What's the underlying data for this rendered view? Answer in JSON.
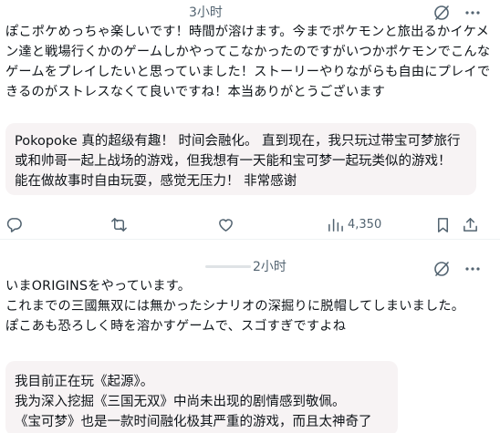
{
  "posts": [
    {
      "time": "3小时",
      "original_text": "ぽこポケめっちゃ楽しいです！時間が溶けます。今までポケモンと旅出るかイケメン達と戦場行くかのゲームしかやってこなかったのですがいつかポケモンでこんなゲームをプレイしたいと思っていました！ストーリーやりながらも自由にプレイできるのがストレスなくて良いですね！本当ありがとうございます",
      "translation": "Pokopoke 真的超级有趣！ 时间会融化。 直到现在，我只玩过带宝可梦旅行或和帅哥一起上战场的游戏，但我想有一天能和宝可梦一起玩类似的游戏！ 能在做故事时自由玩耍，感觉无压力！ 非常感谢",
      "views": "4,350"
    },
    {
      "time": "2小时",
      "original_text": "いまORIGINSをやっています。\nこれまでの三國無双には無かったシナリオの深掘りに脱帽してしまいました。\nぽこあも恐ろしく時を溶かすゲームで、スゴすぎですよね",
      "translation": "我目前正在玩《起源》。\n我为深入挖掘《三国无双》中尚未出现的剧情感到敬佩。\n《宝可梦》也是一款时间融化极其严重的游戏，而且太神奇了"
    }
  ]
}
